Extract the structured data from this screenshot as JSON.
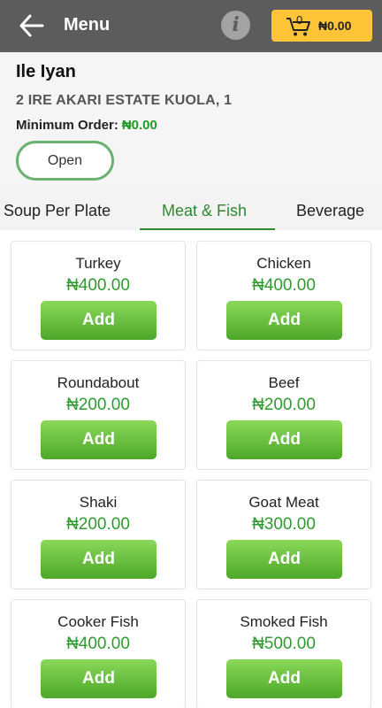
{
  "header": {
    "title": "Menu",
    "info_glyph": "i",
    "cart": {
      "count": "0",
      "total": "₦0.00"
    },
    "icons": {
      "back": "arrow-left-icon",
      "info": "info-icon",
      "cart": "cart-icon"
    },
    "colors": {
      "bar": "#5c5c5c",
      "cart_bg": "#fcc436"
    }
  },
  "restaurant": {
    "name": "Ile Iyan",
    "address": "2 IRE AKARI ESTATE KUOLA, 1",
    "min_order_label": "Minimum Order:",
    "min_order_value": "₦0.00",
    "status": "Open"
  },
  "tabs": [
    {
      "label": "Soup Per Plate",
      "active": false
    },
    {
      "label": "Meat & Fish",
      "active": true
    },
    {
      "label": "Beverage",
      "active": false
    }
  ],
  "items": [
    {
      "name": "Turkey",
      "price": "₦400.00",
      "button": "Add"
    },
    {
      "name": "Chicken",
      "price": "₦400.00",
      "button": "Add"
    },
    {
      "name": "Roundabout",
      "price": "₦200.00",
      "button": "Add"
    },
    {
      "name": "Beef",
      "price": "₦200.00",
      "button": "Add"
    },
    {
      "name": "Shaki",
      "price": "₦200.00",
      "button": "Add"
    },
    {
      "name": "Goat Meat",
      "price": "₦300.00",
      "button": "Add"
    },
    {
      "name": "Cooker Fish",
      "price": "₦400.00",
      "button": "Add"
    },
    {
      "name": "Smoked Fish",
      "price": "₦500.00",
      "button": "Add"
    }
  ],
  "theme": {
    "accent_green": "#2c8a2f",
    "price_green": "#2f9a2f"
  }
}
